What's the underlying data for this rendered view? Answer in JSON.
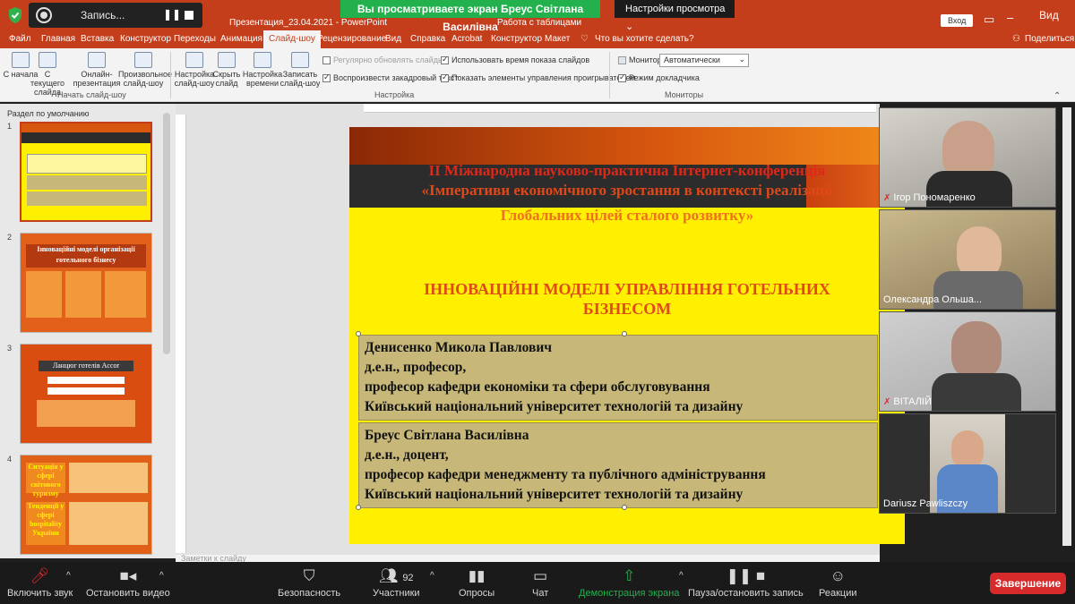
{
  "zoom": {
    "recording_label": "Запись...",
    "share_banner": "Вы просматриваете экран Бреус Світлана Василівна",
    "view_options": "Настройки просмотра",
    "participants_count": "92",
    "toolbar": {
      "mute": "Включить звук",
      "video": "Остановить видео",
      "security": "Безопасность",
      "participants": "Участники",
      "polls": "Опросы",
      "chat": "Чат",
      "share": "Демонстрация экрана",
      "record": "Пауза/остановить запись",
      "reactions": "Реакции",
      "end": "Завершение"
    },
    "gallery": [
      {
        "name": "Ігор Пономаренко",
        "muted": true
      },
      {
        "name": "Олександра Ольша...",
        "muted": false
      },
      {
        "name": "ВІТАЛІЙ",
        "muted": true
      },
      {
        "name": "Dariusz Pawliszczy",
        "muted": false
      }
    ]
  },
  "ppt": {
    "window_title": "Презентация_23.04.2021 - PowerPoint",
    "contextual_tab": "Работа с таблицами",
    "signin": "Вход",
    "view_label": "Вид",
    "tabs": [
      "Файл",
      "Главная",
      "Вставка",
      "Конструктор",
      "Переходы",
      "Анимация",
      "Слайд-шоу",
      "Рецензирование",
      "Вид",
      "Справка",
      "Acrobat",
      "Конструктор",
      "Макет"
    ],
    "tell_me": "Что вы хотите сделать?",
    "share": "Поделиться",
    "ribbon": {
      "btn_from_start": "С начала",
      "btn_from_current": "С текущего слайда",
      "btn_online": "Онлайн-презентация",
      "btn_custom": "Произвольное слайд-шоу",
      "group_start": "Начать слайд-шоу",
      "btn_setup": "Настройка слайд-шоу",
      "btn_hide": "Скрыть слайд",
      "btn_timing": "Настройка времени",
      "btn_record": "Записать слайд-шоу",
      "chk_update": "Регулярно обновлять слайды",
      "chk_narration": "Воспроизвести закадровый текст",
      "chk_timings": "Использовать время показа слайдов",
      "chk_controls": "Показать элементы управления проигрывателем",
      "group_setup": "Настройка",
      "monitor_label": "Монитор:",
      "monitor_value": "Автоматически",
      "chk_presenter": "Режим докладчика",
      "group_monitors": "Мониторы"
    },
    "section": "Раздел по умолчанию",
    "notes_placeholder": "Заметки к слайду"
  },
  "slide": {
    "conf_line1": "ІІ Міжнародна науково-практична Інтернет-конференція",
    "conf_line2": "«Імперативи економічного зростання в контексті реалізації",
    "conf_line3": "Глобальних цілей сталого розвитку»",
    "heading_line1": "ІННОВАЦІЙНІ МОДЕЛІ УПРАВЛІННЯ ГОТЕЛЬНИХ",
    "heading_line2": "БІЗНЕСОМ",
    "author1": [
      "Денисенко Микола Павлович",
      "д.е.н., професор,",
      "професор кафедри економіки та сфери обслуговування",
      "Київський національний університет технологій та дизайну"
    ],
    "author2": [
      "Бреус Світлана Василівна",
      "д.е.н., доцент,",
      "професор кафедри менеджменту та публічного адміністрування",
      "Київський національний університет технологій та дизайну"
    ]
  },
  "thumbs": {
    "t2_title": "Інноваційні моделі організації готельного бізнесу",
    "t3_title": "Ланцюг готелів Accor",
    "t4_left1": "Ситуація у сфері світового туризму",
    "t4_left2": "Тенденції у сфері hospitality України",
    "slide_numbers": [
      "1",
      "2",
      "3",
      "4"
    ]
  }
}
